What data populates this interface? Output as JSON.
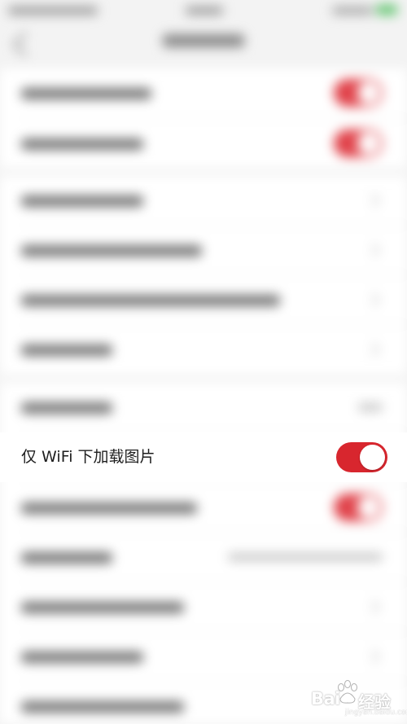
{
  "settings": {
    "wifi_image_row": {
      "label": "仅 WiFi 下加载图片",
      "enabled": true
    }
  },
  "colors": {
    "toggle_on": "#d8262e",
    "background": "#f3f3f3",
    "row_background": "#ffffff"
  },
  "icons": {
    "watermark_logo": "baidu-paw-icon"
  },
  "watermark": {
    "brand": "Bai",
    "tail": "经验",
    "url": "jingyan.baidu.com"
  }
}
